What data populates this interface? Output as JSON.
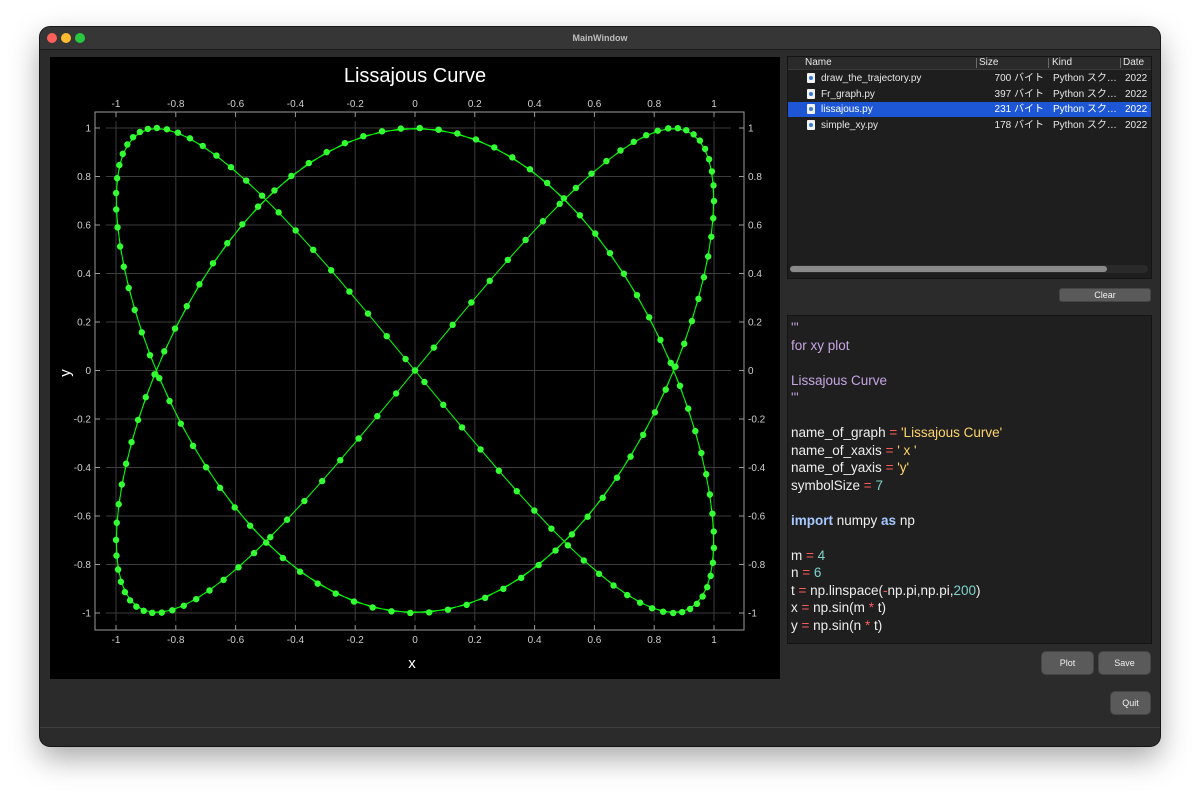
{
  "window": {
    "title": "MainWindow"
  },
  "plot": {
    "title": "Lissajous Curve",
    "xlabel": "x",
    "ylabel": "y",
    "line_color": "#00ff00",
    "symbol_color": "#33ff33",
    "background": "#000000"
  },
  "chart_data": {
    "type": "line",
    "title": "Lissajous Curve",
    "xlabel": "x",
    "ylabel": "y",
    "xlim": [
      -1,
      1
    ],
    "ylim": [
      -1,
      1
    ],
    "xticks": [
      "-1",
      "-0.8",
      "-0.6",
      "-0.4",
      "-0.2",
      "0",
      "0.2",
      "0.4",
      "0.6",
      "0.8",
      "1"
    ],
    "yticks": [
      "1",
      "0.8",
      "0.6",
      "0.4",
      "0.2",
      "0",
      "-0.2",
      "-0.4",
      "-0.6",
      "-0.8",
      "-1"
    ],
    "grid": true,
    "series": [
      {
        "function": "x = sin(4 t), y = sin(6 t)",
        "t_range": [
          -3.14159,
          3.14159
        ],
        "samples": 200,
        "symbol_size": 7
      }
    ]
  },
  "filelist": {
    "columns": [
      "Name",
      "Size",
      "Kind",
      "Date"
    ],
    "rows": [
      {
        "name": "draw_the_trajectory.py",
        "size": "700 バイト",
        "kind": "Python スク…",
        "date": "2022",
        "selected": false
      },
      {
        "name": "Fr_graph.py",
        "size": "397 バイト",
        "kind": "Python スク…",
        "date": "2022",
        "selected": false
      },
      {
        "name": "lissajous.py",
        "size": "231 バイト",
        "kind": "Python スク…",
        "date": "2022",
        "selected": true
      },
      {
        "name": "simple_xy.py",
        "size": "178 バイト",
        "kind": "Python スク…",
        "date": "2022",
        "selected": false
      }
    ]
  },
  "buttons": {
    "clear": "Clear",
    "plot": "Plot",
    "save": "Save",
    "quit": "Quit"
  },
  "editor": {
    "lines": [
      {
        "t": [
          [
            "doc",
            "'''"
          ]
        ]
      },
      {
        "t": [
          [
            "doc",
            "for xy plot"
          ]
        ]
      },
      {
        "t": []
      },
      {
        "t": [
          [
            "doc",
            "Lissajous Curve"
          ]
        ]
      },
      {
        "t": [
          [
            "doc",
            "'''"
          ]
        ]
      },
      {
        "t": []
      },
      {
        "t": [
          [
            "plain",
            "name_of_graph "
          ],
          [
            "op",
            "="
          ],
          [
            "plain",
            " "
          ],
          [
            "str",
            "'Lissajous Curve'"
          ]
        ]
      },
      {
        "t": [
          [
            "plain",
            "name_of_xaxis "
          ],
          [
            "op",
            "="
          ],
          [
            "plain",
            " "
          ],
          [
            "str",
            "' x '"
          ]
        ]
      },
      {
        "t": [
          [
            "plain",
            "name_of_yaxis "
          ],
          [
            "op",
            "="
          ],
          [
            "plain",
            " "
          ],
          [
            "str",
            "'y'"
          ]
        ]
      },
      {
        "t": [
          [
            "plain",
            "symbolSize "
          ],
          [
            "op",
            "="
          ],
          [
            "plain",
            " "
          ],
          [
            "num",
            "7"
          ]
        ]
      },
      {
        "t": []
      },
      {
        "t": [
          [
            "kw",
            "import"
          ],
          [
            "plain",
            " numpy "
          ],
          [
            "kw",
            "as"
          ],
          [
            "plain",
            " np"
          ]
        ]
      },
      {
        "t": []
      },
      {
        "t": [
          [
            "plain",
            "m "
          ],
          [
            "op",
            "="
          ],
          [
            "plain",
            " "
          ],
          [
            "num",
            "4"
          ]
        ]
      },
      {
        "t": [
          [
            "plain",
            "n "
          ],
          [
            "op",
            "="
          ],
          [
            "plain",
            " "
          ],
          [
            "num",
            "6"
          ]
        ]
      },
      {
        "t": [
          [
            "plain",
            "t "
          ],
          [
            "op",
            "="
          ],
          [
            "plain",
            " np.linspace("
          ],
          [
            "op",
            "-"
          ],
          [
            "plain",
            "np.pi,np.pi,"
          ],
          [
            "num",
            "200"
          ],
          [
            "plain",
            ")"
          ]
        ]
      },
      {
        "t": [
          [
            "plain",
            "x "
          ],
          [
            "op",
            "="
          ],
          [
            "plain",
            " np.sin(m "
          ],
          [
            "op",
            "*"
          ],
          [
            "plain",
            " t)"
          ]
        ]
      },
      {
        "t": [
          [
            "plain",
            "y "
          ],
          [
            "op",
            "="
          ],
          [
            "plain",
            " np.sin(n "
          ],
          [
            "op",
            "*"
          ],
          [
            "plain",
            " t)"
          ]
        ]
      }
    ]
  }
}
